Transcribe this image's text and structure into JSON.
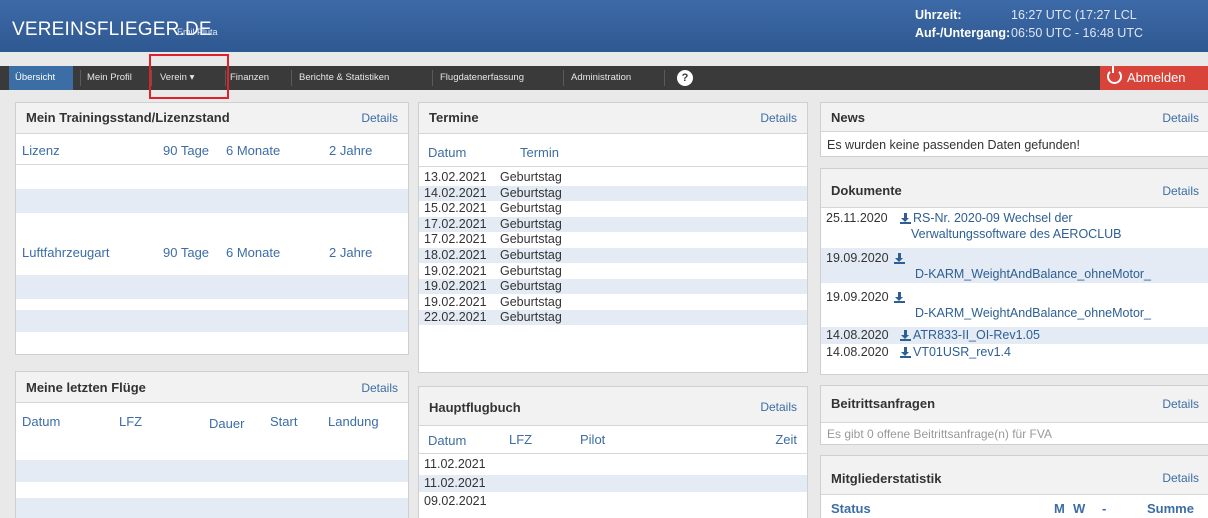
{
  "header": {
    "brand": "VEREINSFLIEGER.DE",
    "user": "Emil Pluta",
    "time_label": "Uhrzeit:",
    "time_value": "16:27 UTC (17:27 LCL",
    "sun_label": "Auf-/Untergang:",
    "sun_value": "06:50 UTC - 16:48 UTC"
  },
  "nav": {
    "items": [
      {
        "label": "Übersicht",
        "active": true
      },
      {
        "label": "Mein Profil"
      },
      {
        "label": "Verein ▾"
      },
      {
        "label": "Finanzen"
      },
      {
        "label": "Berichte & Statistiken"
      },
      {
        "label": "Flugdatenerfassung"
      },
      {
        "label": "Administration"
      }
    ],
    "help": "?",
    "logout": "Abmelden"
  },
  "training": {
    "title": "Mein Trainingsstand/Lizenzstand",
    "details": "Details",
    "lizenz_headers": [
      "Lizenz",
      "90 Tage",
      "6 Monate",
      "2 Jahre"
    ],
    "lfz_headers": [
      "Luftfahrzeugart",
      "90 Tage",
      "6 Monate",
      "2 Jahre"
    ]
  },
  "flights": {
    "title": "Meine letzten Flüge",
    "details": "Details",
    "headers": [
      "Datum",
      "LFZ",
      "Dauer",
      "Start",
      "Landung"
    ]
  },
  "termine": {
    "title": "Termine",
    "details": "Details",
    "headers": [
      "Datum",
      "Termin"
    ],
    "rows": [
      {
        "date": "13.02.2021",
        "event": "Geburtstag"
      },
      {
        "date": "14.02.2021",
        "event": "Geburtstag"
      },
      {
        "date": "15.02.2021",
        "event": "Geburtstag"
      },
      {
        "date": "17.02.2021",
        "event": "Geburtstag"
      },
      {
        "date": "17.02.2021",
        "event": "Geburtstag"
      },
      {
        "date": "18.02.2021",
        "event": "Geburtstag"
      },
      {
        "date": "19.02.2021",
        "event": "Geburtstag"
      },
      {
        "date": "19.02.2021",
        "event": "Geburtstag"
      },
      {
        "date": "19.02.2021",
        "event": "Geburtstag"
      },
      {
        "date": "22.02.2021",
        "event": "Geburtstag"
      }
    ]
  },
  "hauptflugbuch": {
    "title": "Hauptflugbuch",
    "details": "Details",
    "headers": [
      "Datum",
      "LFZ",
      "Pilot",
      "Zeit"
    ],
    "rows": [
      "11.02.2021",
      "11.02.2021",
      "09.02.2021"
    ]
  },
  "news": {
    "title": "News",
    "details": "Details",
    "message": "Es wurden keine passenden Daten gefunden!"
  },
  "dokumente": {
    "title": "Dokumente",
    "details": "Details",
    "items": [
      {
        "date": "25.11.2020",
        "name": "RS-Nr. 2020-09 Wechsel der",
        "name2": "Verwaltungssoftware des AEROCLUB"
      },
      {
        "date": "19.09.2020",
        "name": "D-KARM_WeightAndBalance_ohneMotor_"
      },
      {
        "date": "19.09.2020",
        "name": "D-KARM_WeightAndBalance_ohneMotor_"
      },
      {
        "date": "14.08.2020",
        "name": "ATR833-II_OI-Rev1.05"
      },
      {
        "date": "14.08.2020",
        "name": "VT01USR_rev1.4"
      }
    ]
  },
  "beitritt": {
    "title": "Beitrittsanfragen",
    "details": "Details",
    "message": "Es gibt 0 offene Beitrittsanfrage(n) für FVA"
  },
  "mitglieder": {
    "title": "Mitgliederstatistik",
    "details": "Details",
    "headers": [
      "Status",
      "M",
      "W",
      "-",
      "Summe"
    ]
  }
}
